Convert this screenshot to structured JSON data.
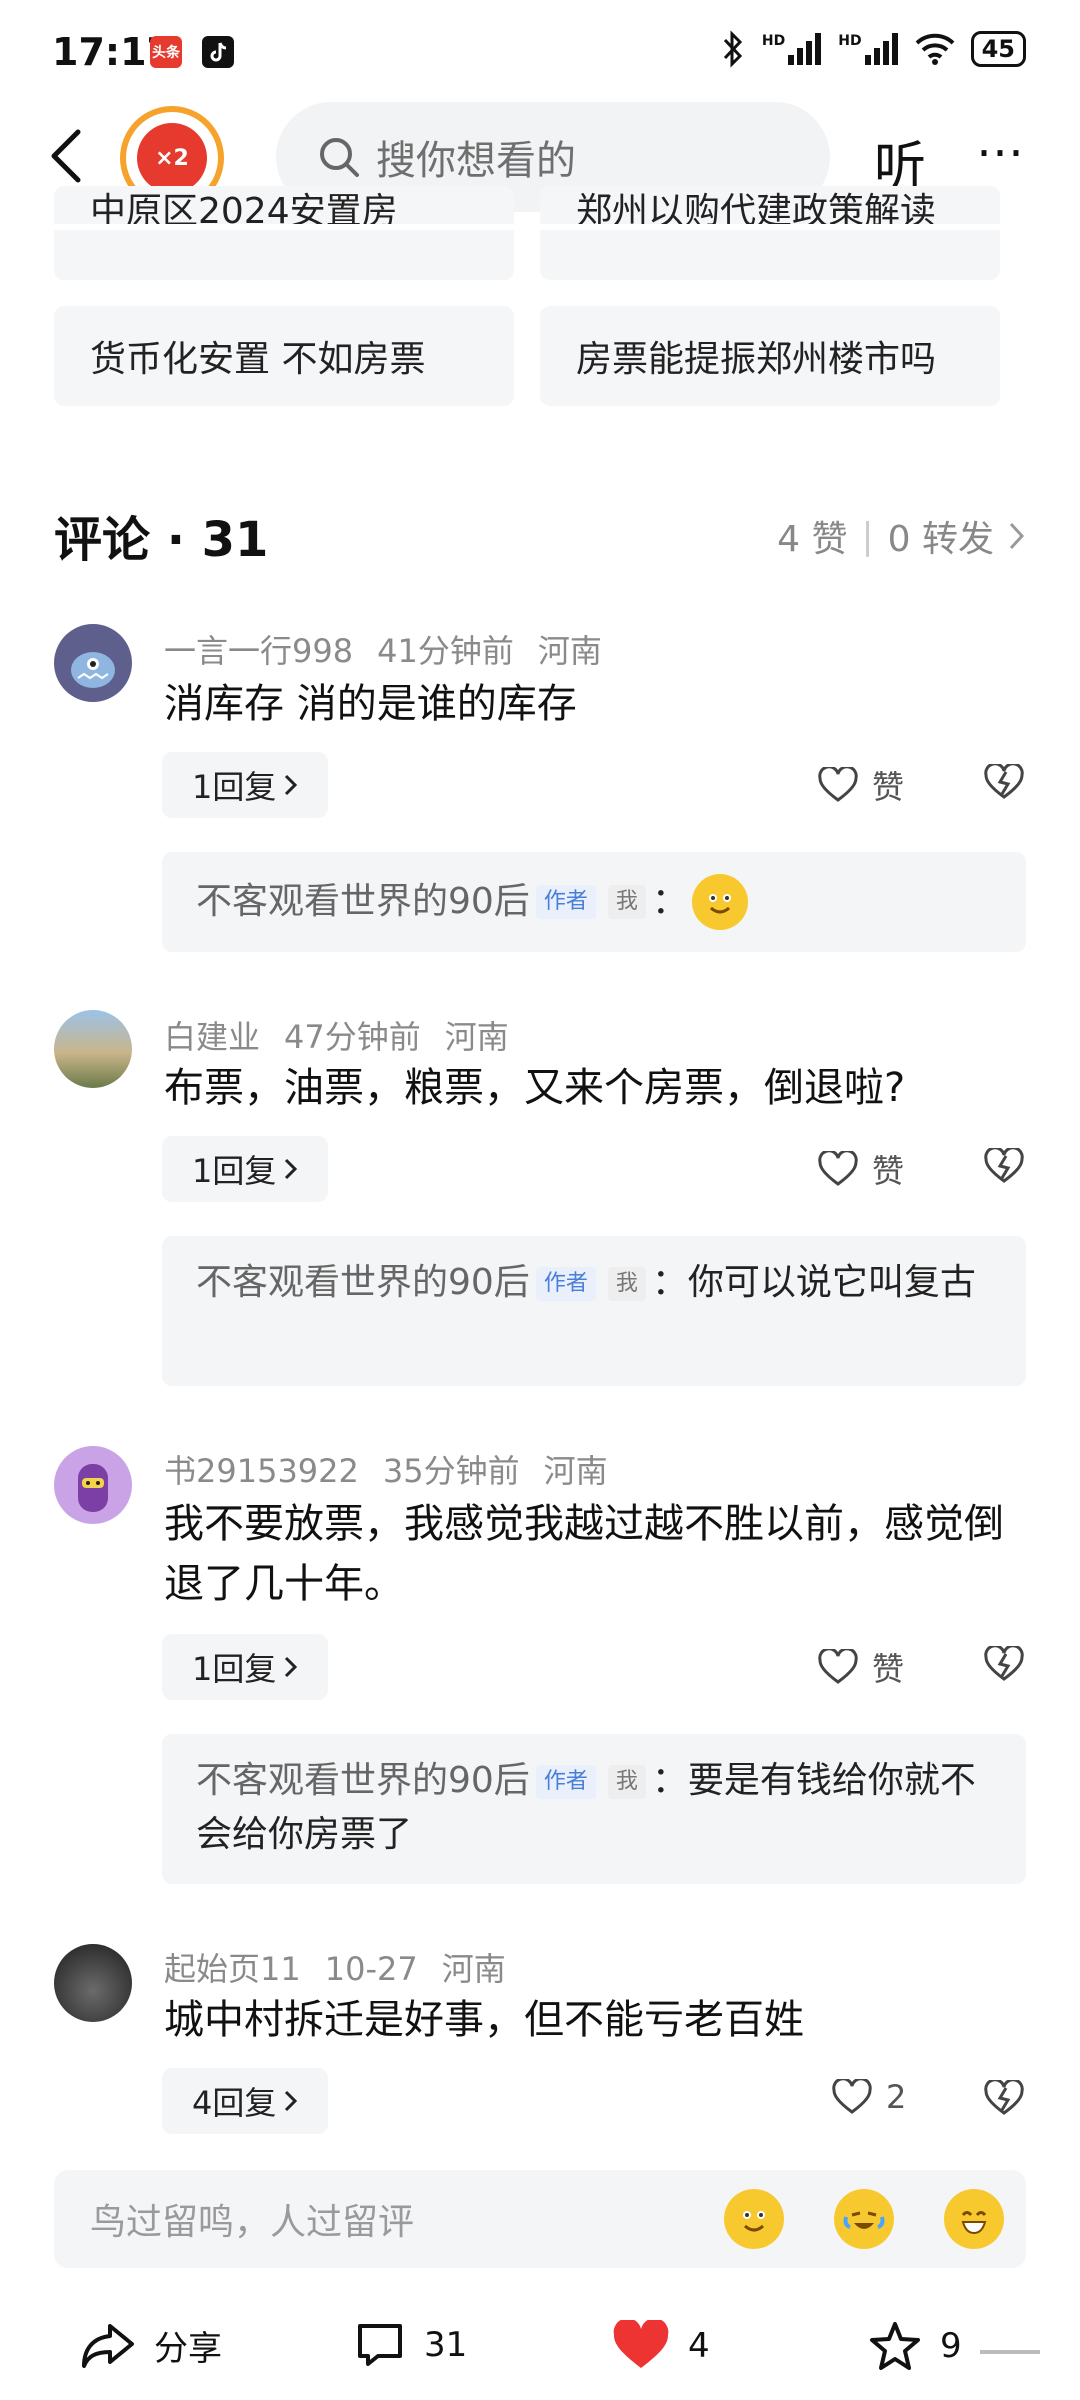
{
  "status_bar": {
    "time": "17:17",
    "app_badge_1": "头条",
    "signal_1_label": "HD",
    "signal_2_label": "HD",
    "battery": "45"
  },
  "header": {
    "multiplier": "×2",
    "search_placeholder": "搜你想看的",
    "listen_label": "听"
  },
  "related": [
    "中原区2024安置房",
    "郑州以购代建政策解读",
    "货币化安置 不如房票",
    "房票能提振郑州楼市吗"
  ],
  "comments_header": {
    "title": "评论 · 31",
    "likes": "4 赞",
    "reposts": "0 转发"
  },
  "comments": [
    {
      "user": "一言一行998",
      "time": "41分钟前",
      "location": "河南",
      "text": "消库存 消的是谁的库存",
      "replies": "1回复",
      "like_label": "赞",
      "sub_reply": {
        "author": "不客观看世界的90后",
        "author_tag": "作者",
        "me_tag": "我",
        "text": "："
      }
    },
    {
      "user": "白建业",
      "time": "47分钟前",
      "location": "河南",
      "text": "布票，油票，粮票，又来个房票，倒退啦?",
      "replies": "1回复",
      "like_label": "赞",
      "sub_reply": {
        "author": "不客观看世界的90后",
        "author_tag": "作者",
        "me_tag": "我",
        "text": "：你可以说它叫复古"
      }
    },
    {
      "user": "书29153922",
      "time": "35分钟前",
      "location": "河南",
      "text": "我不要放票，我感觉我越过越不胜以前，感觉倒退了几十年。",
      "replies": "1回复",
      "like_label": "赞",
      "sub_reply": {
        "author": "不客观看世界的90后",
        "author_tag": "作者",
        "me_tag": "我",
        "text": "：要是有钱给你就不会给你房票了"
      }
    },
    {
      "user": "起始页11",
      "time": "10-27",
      "location": "河南",
      "text": "城中村拆迁是好事，但不能亏老百姓",
      "replies": "4回复",
      "like_label": "2"
    }
  ],
  "input_bar": {
    "placeholder": "鸟过留鸣，人过留评"
  },
  "bottom_bar": {
    "share": "分享",
    "comments": "31",
    "likes": "4",
    "favorites": "9"
  },
  "colors": {
    "accent_red": "#e63a2e",
    "badge_orange": "#f6a22d",
    "author_tag_blue": "#4a7ed8",
    "heart_red": "#ee3333"
  }
}
